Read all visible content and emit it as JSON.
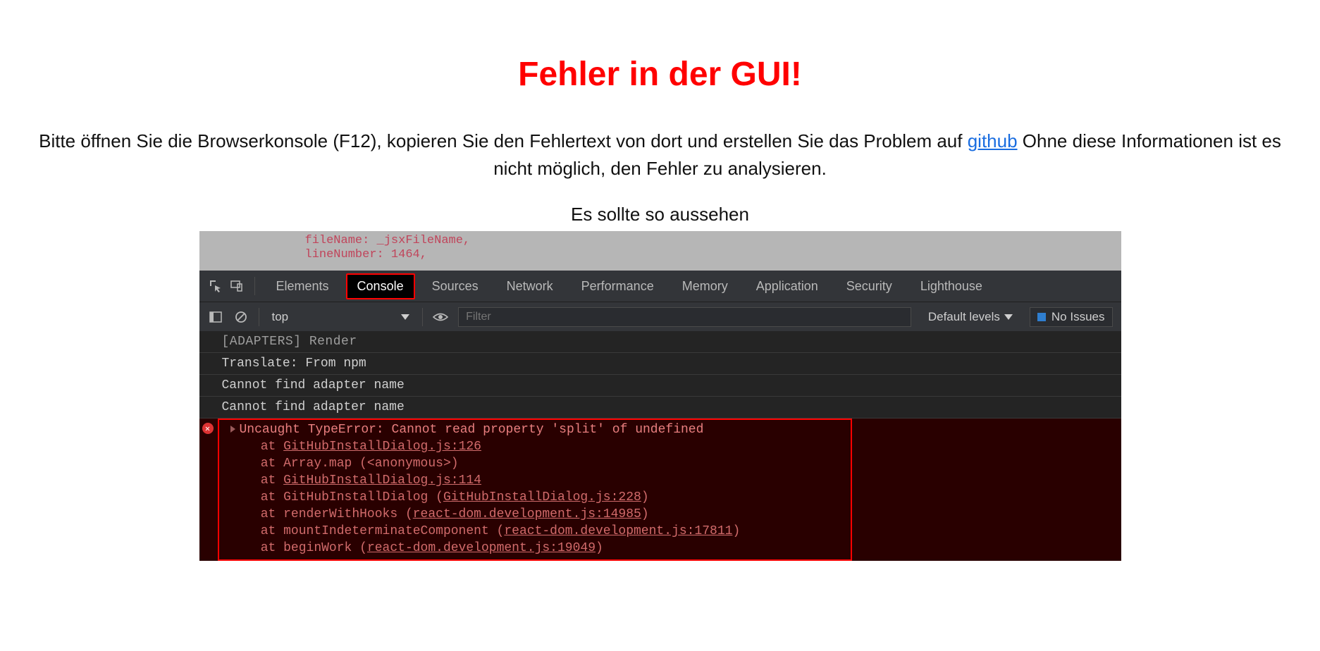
{
  "title": "Fehler in der GUI!",
  "instruction": {
    "before_link": "Bitte öffnen Sie die Browserkonsole (F12), kopieren Sie den Fehlertext von dort und erstellen Sie das Problem auf ",
    "link_text": "github",
    "after_link": " Ohne diese Informationen ist es nicht möglich, den Fehler zu analysieren."
  },
  "caption": "Es sollte so aussehen",
  "code_strip": {
    "line1": "fileName: _jsxFileName,",
    "line2": "lineNumber: 1464,"
  },
  "devtools": {
    "tabs": {
      "elements": "Elements",
      "console": "Console",
      "sources": "Sources",
      "network": "Network",
      "performance": "Performance",
      "memory": "Memory",
      "application": "Application",
      "security": "Security",
      "lighthouse": "Lighthouse"
    },
    "filterbar": {
      "context": "top",
      "filter_placeholder": "Filter",
      "levels": "Default levels",
      "issues": "No Issues"
    },
    "logs": {
      "l0": "[ADAPTERS] Render",
      "l1": "Translate: From npm",
      "l2": "Cannot find adapter name",
      "l3": "Cannot find adapter name"
    },
    "error": {
      "head": "Uncaught TypeError: Cannot read property 'split' of undefined",
      "s1_at": "    at ",
      "s1_u": "GitHubInstallDialog.js:126",
      "s2": "    at Array.map (<anonymous>)",
      "s3_at": "    at ",
      "s3_u": "GitHubInstallDialog.js:114",
      "s4_a": "    at GitHubInstallDialog (",
      "s4_u": "GitHubInstallDialog.js:228",
      "s4_b": ")",
      "s5_a": "    at renderWithHooks (",
      "s5_u": "react-dom.development.js:14985",
      "s5_b": ")",
      "s6_a": "    at mountIndeterminateComponent (",
      "s6_u": "react-dom.development.js:17811",
      "s6_b": ")",
      "s7_a": "    at beginWork (",
      "s7_u": "react-dom.development.js:19049",
      "s7_b": ")"
    }
  }
}
